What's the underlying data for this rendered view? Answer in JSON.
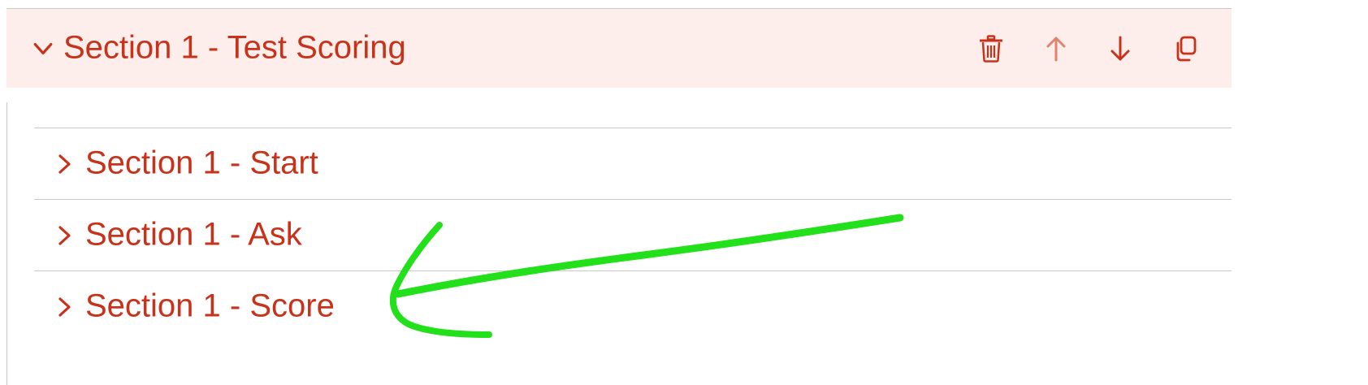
{
  "colors": {
    "accent": "#c8321a",
    "header_bg": "#fdeeeb",
    "divider": "#c9c9c9",
    "annotation_arrow": "#22e01a"
  },
  "section": {
    "title": "Section 1 - Test Scoring",
    "expanded": true,
    "toggle_icon": "chevron-down-icon",
    "actions": [
      {
        "name": "delete",
        "icon": "trash-icon"
      },
      {
        "name": "move-up",
        "icon": "arrow-up-icon"
      },
      {
        "name": "move-down",
        "icon": "arrow-down-icon"
      },
      {
        "name": "duplicate",
        "icon": "copy-icon"
      }
    ],
    "subsections": [
      {
        "label": "Section 1 - Start",
        "icon": "chevron-right-icon"
      },
      {
        "label": "Section 1 - Ask",
        "icon": "chevron-right-icon"
      },
      {
        "label": "Section 1 - Score",
        "icon": "chevron-right-icon"
      }
    ]
  },
  "annotation": {
    "type": "hand-drawn-arrow",
    "points_to": "Section 1 - Score"
  }
}
